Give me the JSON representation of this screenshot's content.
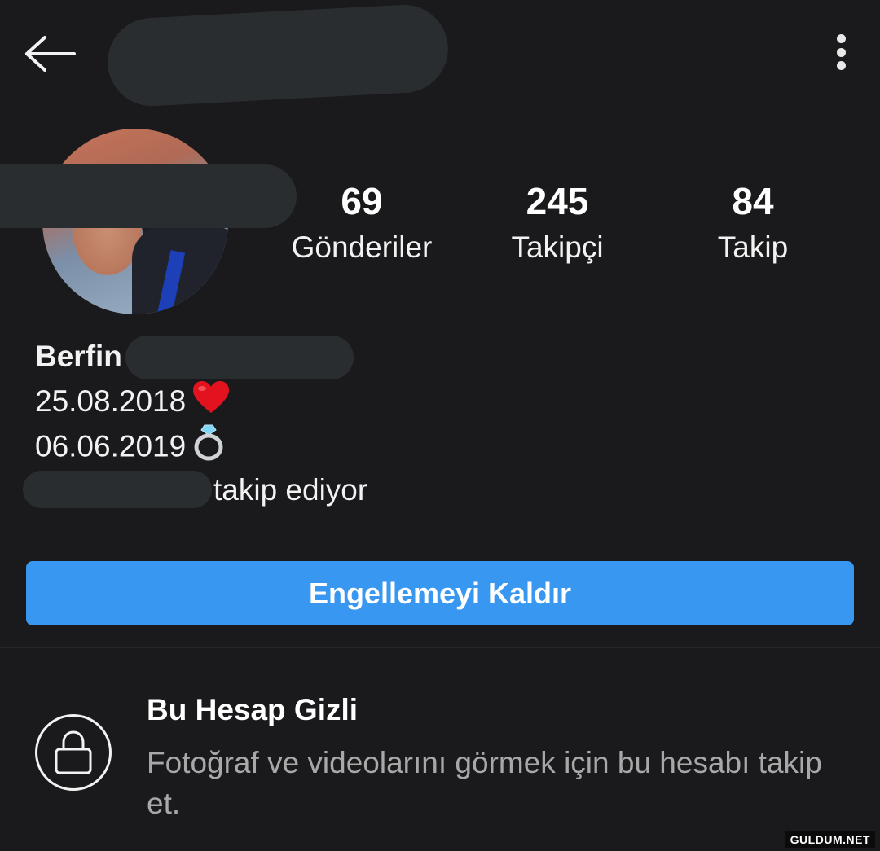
{
  "header": {
    "back_icon": "arrow-left-icon",
    "more_icon": "more-vertical-icon"
  },
  "stats": {
    "posts": {
      "count": "69",
      "label": "Gönderiler"
    },
    "followers": {
      "count": "245",
      "label": "Takipçi"
    },
    "following": {
      "count": "84",
      "label": "Takip"
    }
  },
  "bio": {
    "name": "Berfin",
    "line1": "25.08.2018",
    "line1_emoji": "heart-icon",
    "line2": "06.06.2019",
    "line2_emoji": "ring-icon",
    "followed_by_suffix": "takip ediyor"
  },
  "actions": {
    "unblock_label": "Engellemeyi Kaldır"
  },
  "private_notice": {
    "icon": "lock-icon",
    "title": "Bu Hesap Gizli",
    "description": "Fotoğraf ve videolarını görmek için bu hesabı takip et."
  },
  "watermark": "GULDUM.NET",
  "colors": {
    "background": "#1a1a1c",
    "button": "#3897f0",
    "muted_text": "#a8a8a8"
  }
}
